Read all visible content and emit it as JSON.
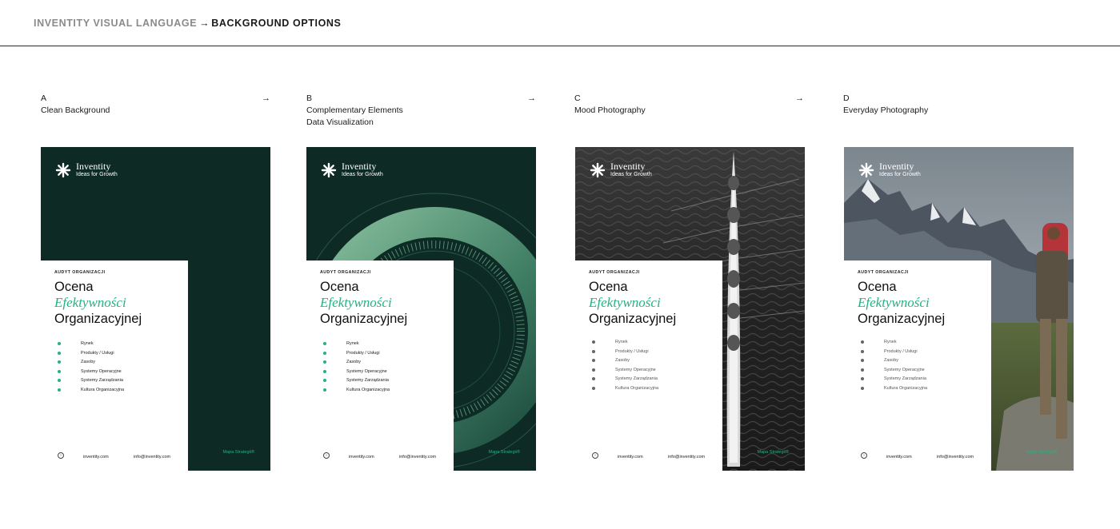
{
  "header": {
    "section": "INVENTITY VISUAL LANGUAGE",
    "arrow": "→",
    "page": "BACKGROUND OPTIONS"
  },
  "columns": [
    {
      "letter": "A",
      "title": "Clean Background",
      "subtitle": "",
      "arrow": "→"
    },
    {
      "letter": "B",
      "title": "Complementary Elements",
      "subtitle": "Data Visualization",
      "arrow": "→"
    },
    {
      "letter": "C",
      "title": "Mood Photography",
      "subtitle": "",
      "arrow": "→"
    },
    {
      "letter": "D",
      "title": "Everyday Photography",
      "subtitle": "",
      "arrow": ""
    }
  ],
  "poster": {
    "brand": "Inventity",
    "tagline": "Ideas for Growth",
    "kicker": "AUDYT ORGANIZACJI",
    "title_line1": "Ocena",
    "title_line2": "Efektywności",
    "title_line3": "Organizacyjnej",
    "items": [
      "Rynek",
      "Produkty / Usługi",
      "Zasoby",
      "Systemy Operacyjne",
      "Systemy Zarządzania",
      "Kultura Organizacyjna"
    ],
    "footer_icon": "›",
    "website": "inventity.com",
    "email": "info@inventity.com",
    "product": "Mapa Strategii®"
  },
  "colors": {
    "dark_green": "#0d2a25",
    "accent_green": "#25b27f",
    "ring_green": "#6fae8d"
  }
}
